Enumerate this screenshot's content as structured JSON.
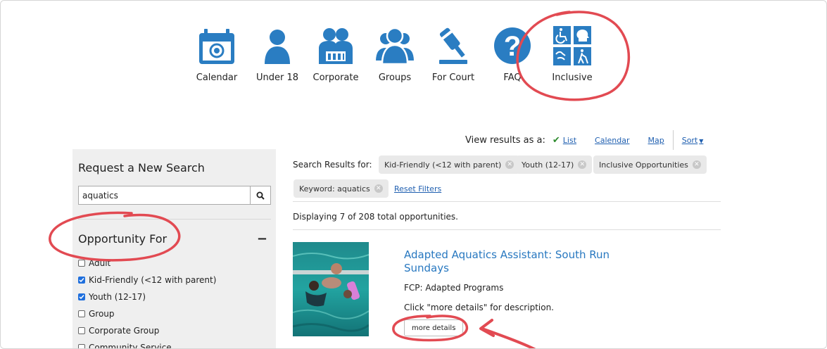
{
  "nav": {
    "items": [
      {
        "label": "Calendar",
        "icon": "calendar-icon"
      },
      {
        "label": "Under 18",
        "icon": "person-icon"
      },
      {
        "label": "Corporate",
        "icon": "corporate-icon"
      },
      {
        "label": "Groups",
        "icon": "groups-icon"
      },
      {
        "label": "For Court",
        "icon": "gavel-icon"
      },
      {
        "label": "FAQ",
        "icon": "question-icon"
      },
      {
        "label": "Inclusive",
        "icon": "accessibility-icon"
      }
    ]
  },
  "view": {
    "label": "View results as a:",
    "list": "List",
    "calendar": "Calendar",
    "map": "Map",
    "sort": "Sort"
  },
  "sidebar": {
    "title": "Request a New Search",
    "search_value": "aquatics",
    "section_title": "Opportunity For",
    "collapse_symbol": "−",
    "filters": [
      {
        "label": "Adult",
        "checked": false
      },
      {
        "label": "Kid-Friendly (<12 with parent)",
        "checked": true
      },
      {
        "label": "Youth (12-17)",
        "checked": true
      },
      {
        "label": "Group",
        "checked": false
      },
      {
        "label": "Corporate Group",
        "checked": false
      },
      {
        "label": "Community Service",
        "checked": false
      }
    ]
  },
  "results": {
    "label": "Search Results for:",
    "chips": [
      "Kid-Friendly (<12 with parent)",
      "Youth (12-17)",
      "Inclusive Opportunities",
      "Keyword: aquatics"
    ],
    "reset": "Reset Filters",
    "count_text": "Displaying 7 of 208 total opportunities.",
    "items": [
      {
        "title": "Adapted Aquatics Assistant: South Run Sundays",
        "org": "FCP: Adapted Programs",
        "desc": "Click \"more details\" for description.",
        "button": "more details"
      }
    ]
  },
  "colors": {
    "icon_blue": "#2a7dc2",
    "link_blue": "#1f5fb0",
    "title_blue": "#2878c0",
    "annotation_red": "#e24a52",
    "sidebar_bg": "#efefef"
  }
}
